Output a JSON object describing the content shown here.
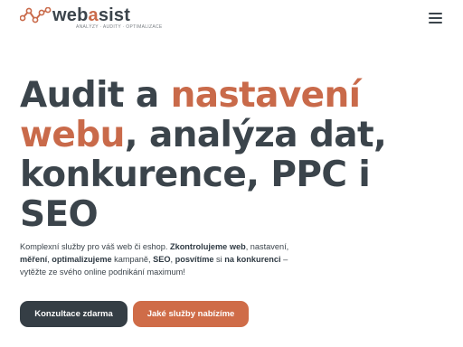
{
  "header": {
    "logo": {
      "word_prefix": "web",
      "word_accent": "a",
      "word_suffix": "sist",
      "tagline": "ANALÝZY · AUDITY · OPTIMALIZACE"
    },
    "menu_icon": "hamburger-menu-icon"
  },
  "hero": {
    "title": {
      "part1": "Audit a ",
      "highlight1": "nastavení",
      "part2": " ",
      "highlight2": "webu",
      "part3": ", analýza dat, konkurence, PPC i SEO"
    },
    "description": {
      "t1": "Komplexní služby pro váš web či eshop. ",
      "b1": "Zkontrolujeme web",
      "t2": ", nastavení, ",
      "b2": "měření",
      "t3": ", ",
      "b3": "optimalizujeme",
      "t4": " kampaně, ",
      "b4": "SEO",
      "t5": ", ",
      "b5": "posvítíme",
      "t6": " si ",
      "b6": "na konkurenci",
      "t7": " – vytěžte ze svého online podnikání maximum!"
    },
    "buttons": {
      "primary": "Konzultace zdarma",
      "secondary": "Jaké služby nabízíme"
    }
  },
  "colors": {
    "accent": "#c96a4a",
    "text_dark": "#3b444b",
    "button_dark": "#353e45",
    "button_accent": "#cf6c48"
  }
}
